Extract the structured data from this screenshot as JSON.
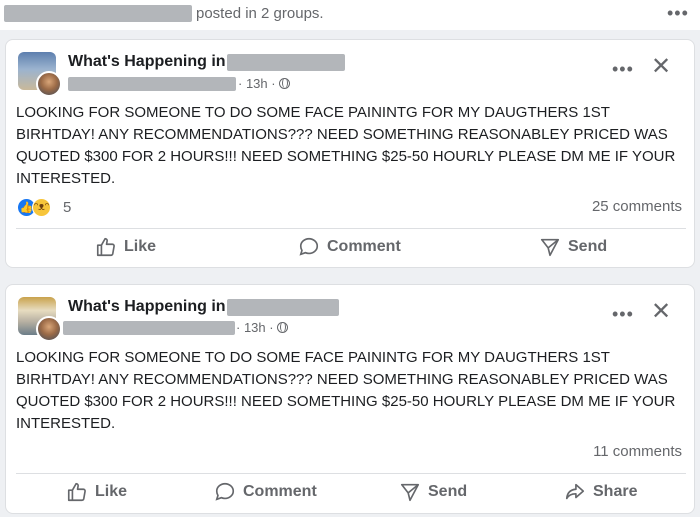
{
  "header": {
    "posted_text": "posted in 2 groups."
  },
  "posts": [
    {
      "group_name": "What's Happening in",
      "time": "13h",
      "body": "LOOKING FOR SOMEONE TO DO SOME FACE PAININTG FOR MY DAUGTHERS 1ST BIRHTDAY! ANY RECOMMENDATIONS??? NEED SOMETHING REASONABLEY PRICED WAS QUOTED $300 FOR 2 HOURS!!! NEED SOMETHING $25-50 HOURLY PLEASE DM ME IF YOUR INTERESTED.",
      "reaction_count": "5",
      "comments": "25 comments",
      "actions": {
        "like": "Like",
        "comment": "Comment",
        "send": "Send"
      }
    },
    {
      "group_name": "What's Happening in",
      "time": "13h",
      "body": "LOOKING FOR SOMEONE TO DO SOME FACE PAININTG FOR MY DAUGTHERS 1ST BIRHTDAY! ANY RECOMMENDATIONS??? NEED SOMETHING REASONABLEY PRICED WAS QUOTED $300 FOR 2 HOURS!!! NEED SOMETHING $25-50 HOURLY PLEASE DM ME IF YOUR INTERESTED.",
      "comments": "11 comments",
      "actions": {
        "like": "Like",
        "comment": "Comment",
        "send": "Send",
        "share": "Share"
      }
    }
  ],
  "icons": {
    "more": "more-horizontal-icon",
    "close": "close-icon",
    "globe": "globe-icon",
    "like": "thumbs-up-icon",
    "comment": "comment-bubble-icon",
    "send": "send-arrow-icon",
    "share": "share-arrow-icon"
  },
  "colors": {
    "muted_text": "#65676b",
    "like_blue": "#1877f2",
    "card_bg": "#ffffff",
    "page_bg": "#eef0f3"
  }
}
